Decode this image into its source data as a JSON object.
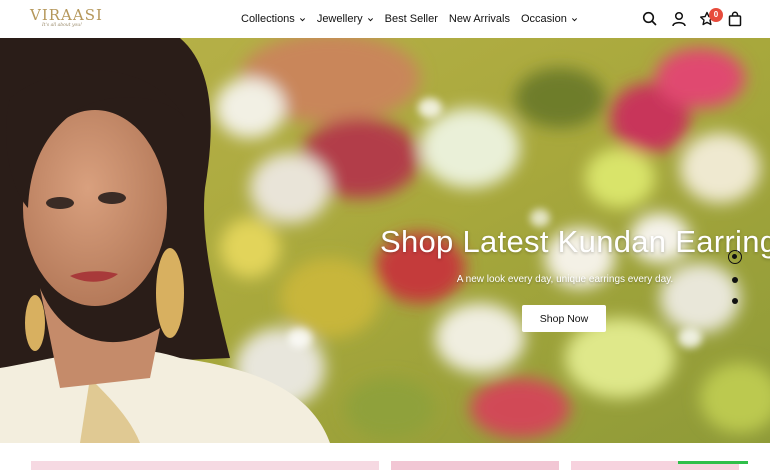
{
  "brand": {
    "name": "VIRAASI",
    "tagline": "It's all about you!",
    "color": "#b5975a"
  },
  "nav": {
    "items": [
      {
        "label": "Collections",
        "dropdown": true
      },
      {
        "label": "Jewellery",
        "dropdown": true
      },
      {
        "label": "Best Seller",
        "dropdown": false
      },
      {
        "label": "New Arrivals",
        "dropdown": false
      },
      {
        "label": "Occasion",
        "dropdown": true
      }
    ]
  },
  "header_icons": {
    "search": "search-icon",
    "account": "user-icon",
    "wishlist": "star-icon",
    "wishlist_count": "0",
    "cart": "shopping-bag-icon",
    "badge_color": "#e74b3c"
  },
  "hero": {
    "title": "Shop Latest Kundan Earrings",
    "subtitle": "A new look every day, unique earrings every day.",
    "cta_label": "Shop Now",
    "slides_count": 3,
    "active_slide": 1
  }
}
